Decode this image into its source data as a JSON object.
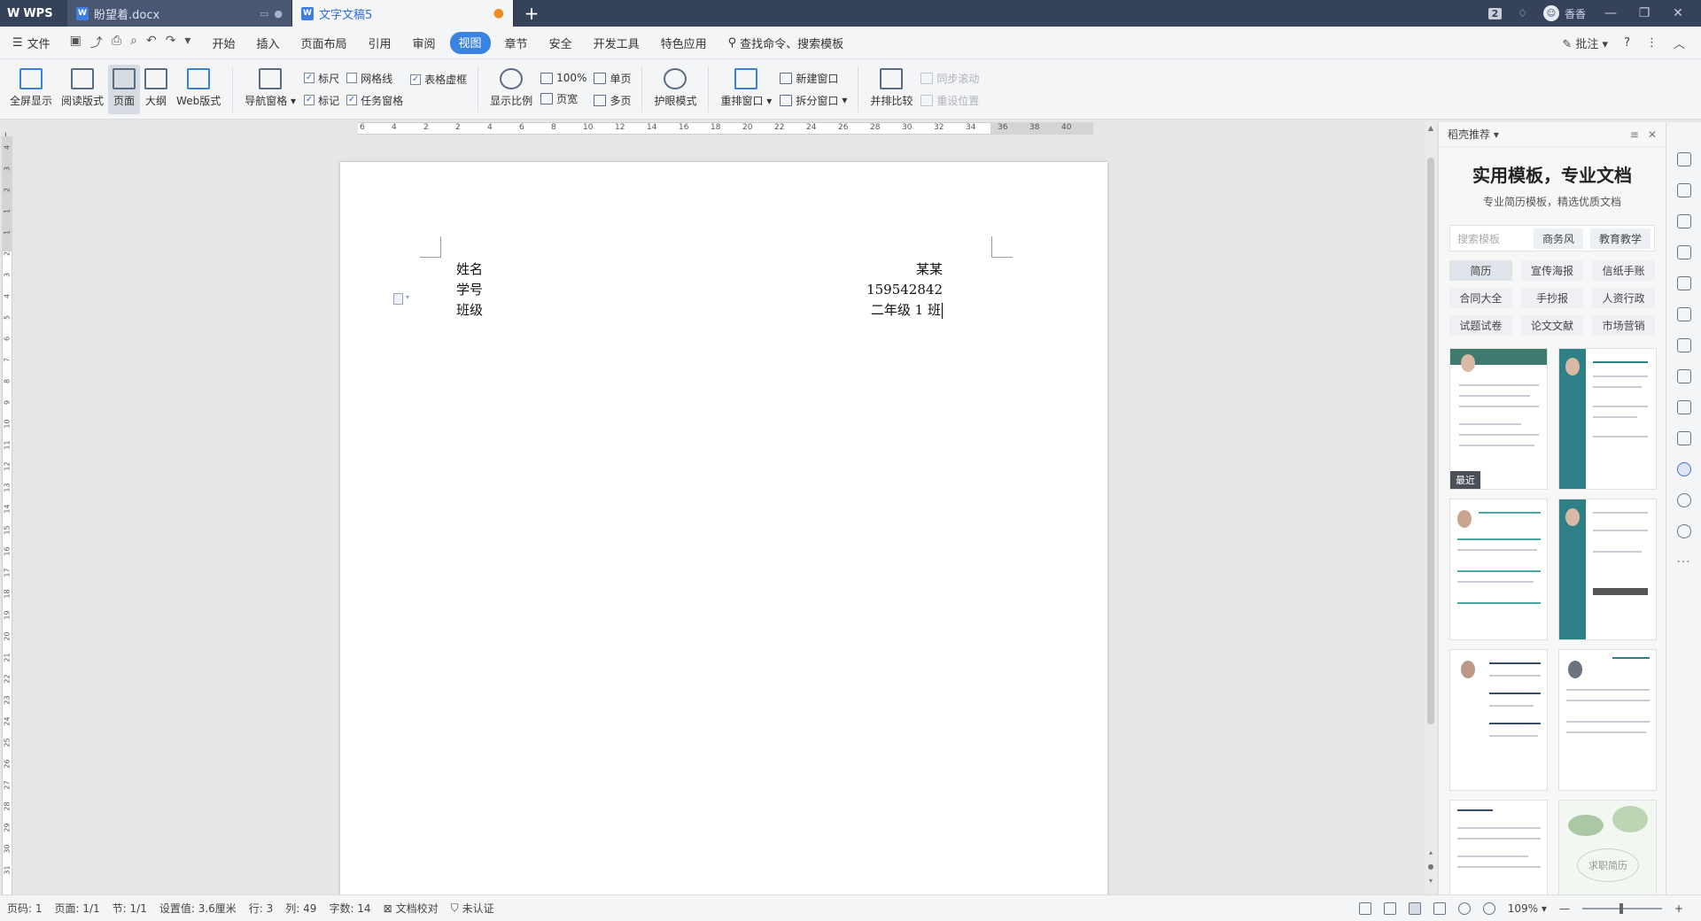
{
  "titlebar": {
    "app_name": "WPS",
    "tabs": [
      {
        "label": "盼望着.docx",
        "icon": "W",
        "state": "inactive"
      },
      {
        "label": "文字文稿5",
        "icon": "W",
        "state": "active"
      }
    ],
    "new_tab": "+",
    "badge": "2",
    "user_name": "香香"
  },
  "menubar": {
    "file_label": "文件",
    "tabs": [
      "开始",
      "插入",
      "页面布局",
      "引用",
      "审阅",
      "视图",
      "章节",
      "安全",
      "开发工具",
      "特色应用"
    ],
    "active_tab": "视图",
    "search_label": "查找命令、搜索模板",
    "annotate_label": "批注"
  },
  "ribbon": {
    "fullscreen": "全屏显示",
    "reading": "阅读版式",
    "page": "页面",
    "outline": "大纲",
    "web": "Web版式",
    "nav_pane": "导航窗格",
    "ruler": "标尺",
    "gridlines": "网格线",
    "table_gridlines": "表格虚框",
    "marks": "标记",
    "task_pane": "任务窗格",
    "zoom": "显示比例",
    "zoom_100": "100%",
    "page_width": "页宽",
    "single_page": "单页",
    "multi_page": "多页",
    "eye_mode": "护眼模式",
    "arrange_windows": "重排窗口",
    "new_window": "新建窗口",
    "split_window": "拆分窗口",
    "side_by_side": "并排比较",
    "sync_scroll": "同步滚动",
    "reset_position": "重设位置",
    "checks": {
      "ruler": true,
      "gridlines": false,
      "table_gridlines": true,
      "marks": true,
      "task_pane": true
    }
  },
  "ruler": {
    "h_labels": [
      "6",
      "4",
      "2",
      "2",
      "4",
      "6",
      "8",
      "10",
      "12",
      "14",
      "16",
      "18",
      "20",
      "22",
      "24",
      "26",
      "28",
      "30",
      "32",
      "34",
      "36",
      "38",
      "40"
    ],
    "v_labels": [
      "4",
      "3",
      "2",
      "1",
      "1",
      "2",
      "3",
      "4",
      "5",
      "6",
      "7",
      "8",
      "9",
      "10",
      "11",
      "12",
      "13",
      "14",
      "15",
      "16",
      "17",
      "18",
      "19",
      "20",
      "21",
      "22",
      "23",
      "24",
      "25",
      "26",
      "27",
      "28",
      "29",
      "30",
      "31"
    ],
    "corner": "L"
  },
  "document": {
    "left_lines": [
      "姓名",
      "学号",
      "班级"
    ],
    "right_lines": [
      "某某",
      "159542842",
      "二年级 1 班"
    ]
  },
  "sidepanel": {
    "header": "稻壳推荐",
    "title": "实用模板，专业文档",
    "subtitle": "专业简历模板，精选优质文档",
    "search_placeholder": "搜索模板",
    "search_pills": [
      "商务风",
      "教育教学"
    ],
    "tags": [
      "简历",
      "宣传海报",
      "信纸手账",
      "合同大全",
      "手抄报",
      "人资行政",
      "试题试卷",
      "论文文献",
      "市场营销"
    ],
    "recent_label": "最近",
    "thumb_caption": "求职简历"
  },
  "statusbar": {
    "page_num": "页码: 1",
    "pages": "页面: 1/1",
    "section": "节: 1/1",
    "position": "设置值: 3.6厘米",
    "row": "行: 3",
    "col": "列: 49",
    "words": "字数: 14",
    "proofread": "文档校对",
    "auth": "未认证",
    "zoom": "109%"
  },
  "colors": {
    "titlebar_bg": "#35425a",
    "accent": "#3a83e0",
    "teal": "#2f7f86"
  }
}
